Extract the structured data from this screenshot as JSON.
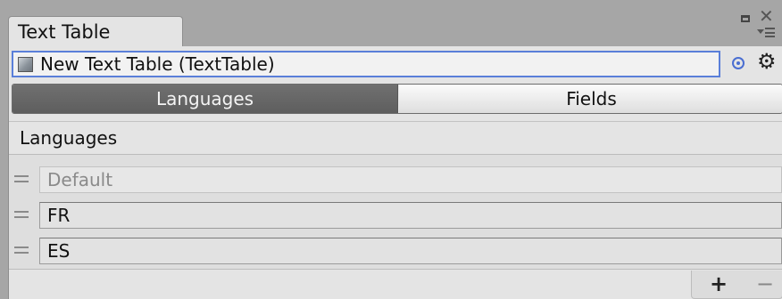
{
  "window": {
    "tab_title": "Text Table"
  },
  "inspector": {
    "object_field_value": "New Text Table (TextTable)"
  },
  "toolbar": {
    "tabs": [
      {
        "label": "Languages",
        "selected": true
      },
      {
        "label": "Fields",
        "selected": false
      }
    ]
  },
  "languages_section": {
    "label": "Languages",
    "items": [
      {
        "value": "Default",
        "editable": false
      },
      {
        "value": "FR",
        "editable": true
      },
      {
        "value": "ES",
        "editable": true
      }
    ],
    "add_label": "+",
    "remove_label": "−"
  },
  "icons": {
    "maximize": "maximize-icon",
    "close": "close-icon",
    "menu": "menu-icon",
    "asset": "asset-icon",
    "target": "target-icon",
    "gear": "gear-icon",
    "drag_handle": "drag-handle-icon"
  },
  "colors": {
    "selected_tab": "#666666",
    "focus_border": "#5a7fd9",
    "panel": "#e4e4e4",
    "background": "#a6a6a6"
  }
}
